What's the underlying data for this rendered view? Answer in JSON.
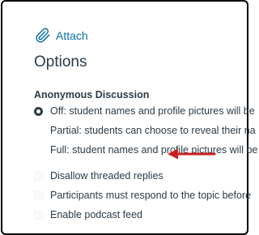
{
  "attach": {
    "label": "Attach",
    "icon": "paperclip-icon",
    "color": "#0770a3"
  },
  "options": {
    "title": "Options"
  },
  "anonymous": {
    "heading": "Anonymous Discussion",
    "choices": [
      {
        "label": "Off: student names and profile pictures will be",
        "checked": true
      },
      {
        "label": "Partial: students can choose to reveal their na",
        "checked": false
      },
      {
        "label": "Full: student names and profile pictures will be",
        "checked": false
      }
    ]
  },
  "settings": {
    "items": [
      {
        "label": "Disallow threaded replies",
        "checked": false
      },
      {
        "label": "Participants must respond to the topic before",
        "checked": false
      },
      {
        "label": "Enable podcast feed",
        "checked": false
      }
    ]
  },
  "annotation": {
    "arrow_color": "#cc1f1f",
    "arrow_icon": "left-arrow-icon"
  }
}
